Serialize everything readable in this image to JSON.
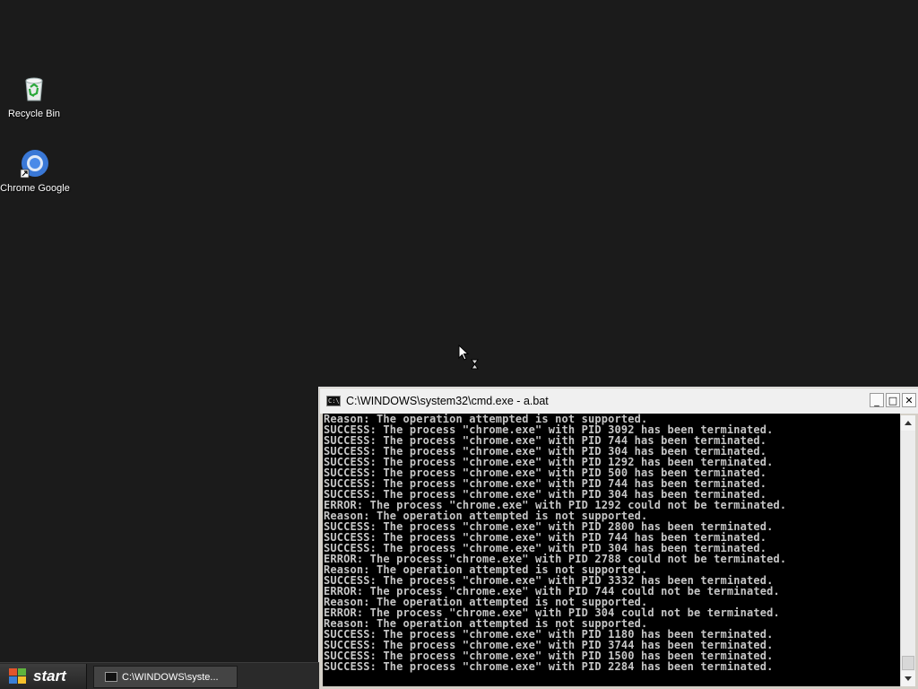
{
  "desktop": {
    "icons": [
      {
        "label": "Recycle Bin",
        "icon": "recycle-bin-icon"
      },
      {
        "label": "Chrome Google",
        "icon": "chrome-icon"
      }
    ]
  },
  "cmd_window": {
    "title": "C:\\WINDOWS\\system32\\cmd.exe - a.bat",
    "icon_text": "C:\\",
    "buttons": {
      "minimize": "_",
      "maximize": "□",
      "close": "✕"
    },
    "lines": [
      "Reason: The operation attempted is not supported.",
      "SUCCESS: The process \"chrome.exe\" with PID 3092 has been terminated.",
      "SUCCESS: The process \"chrome.exe\" with PID 744 has been terminated.",
      "SUCCESS: The process \"chrome.exe\" with PID 304 has been terminated.",
      "SUCCESS: The process \"chrome.exe\" with PID 1292 has been terminated.",
      "SUCCESS: The process \"chrome.exe\" with PID 500 has been terminated.",
      "SUCCESS: The process \"chrome.exe\" with PID 744 has been terminated.",
      "SUCCESS: The process \"chrome.exe\" with PID 304 has been terminated.",
      "ERROR: The process \"chrome.exe\" with PID 1292 could not be terminated.",
      "Reason: The operation attempted is not supported.",
      "SUCCESS: The process \"chrome.exe\" with PID 2800 has been terminated.",
      "SUCCESS: The process \"chrome.exe\" with PID 744 has been terminated.",
      "SUCCESS: The process \"chrome.exe\" with PID 304 has been terminated.",
      "ERROR: The process \"chrome.exe\" with PID 2788 could not be terminated.",
      "Reason: The operation attempted is not supported.",
      "SUCCESS: The process \"chrome.exe\" with PID 3332 has been terminated.",
      "ERROR: The process \"chrome.exe\" with PID 744 could not be terminated.",
      "Reason: The operation attempted is not supported.",
      "ERROR: The process \"chrome.exe\" with PID 304 could not be terminated.",
      "Reason: The operation attempted is not supported.",
      "SUCCESS: The process \"chrome.exe\" with PID 1180 has been terminated.",
      "SUCCESS: The process \"chrome.exe\" with PID 3744 has been terminated.",
      "SUCCESS: The process \"chrome.exe\" with PID 1500 has been terminated.",
      "SUCCESS: The process \"chrome.exe\" with PID 2284 has been terminated."
    ],
    "scroll_position": 1.0
  },
  "taskbar": {
    "start_label": "start",
    "tasks": [
      {
        "label": "C:\\WINDOWS\\syste...",
        "icon": "cmd-icon"
      }
    ]
  },
  "colors": {
    "desktop_bg": "#1b1b1b",
    "console_bg": "#000000",
    "console_fg": "#c6c6c6"
  }
}
